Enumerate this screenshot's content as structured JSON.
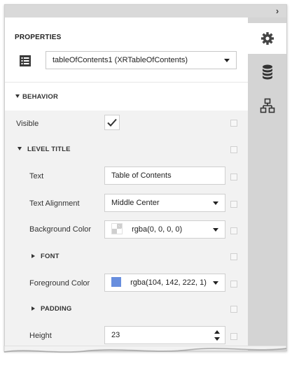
{
  "panel": {
    "title": "PROPERTIES",
    "selected_component": "tableOfContents1 (XRTableOfContents)"
  },
  "side_tabs": [
    {
      "name": "properties",
      "icon": "gear-icon",
      "active": true
    },
    {
      "name": "field-list",
      "icon": "database-icon",
      "active": false
    },
    {
      "name": "report-explorer",
      "icon": "hierarchy-icon",
      "active": false
    }
  ],
  "behavior": {
    "label": "BEHAVIOR",
    "visible_label": "Visible",
    "visible_checked": true
  },
  "level_title": {
    "label": "LEVEL TITLE",
    "text_label": "Text",
    "text_value": "Table of Contents",
    "alignment_label": "Text Alignment",
    "alignment_value": "Middle Center",
    "bg_color_label": "Background Color",
    "bg_color_value": "rgba(0, 0, 0, 0)",
    "font_label": "FONT",
    "fg_color_label": "Foreground Color",
    "fg_color_value": "rgba(104, 142, 222, 1)",
    "fg_color_hex": "#688ede",
    "padding_label": "PADDING",
    "height_label": "Height",
    "height_value": "23"
  }
}
